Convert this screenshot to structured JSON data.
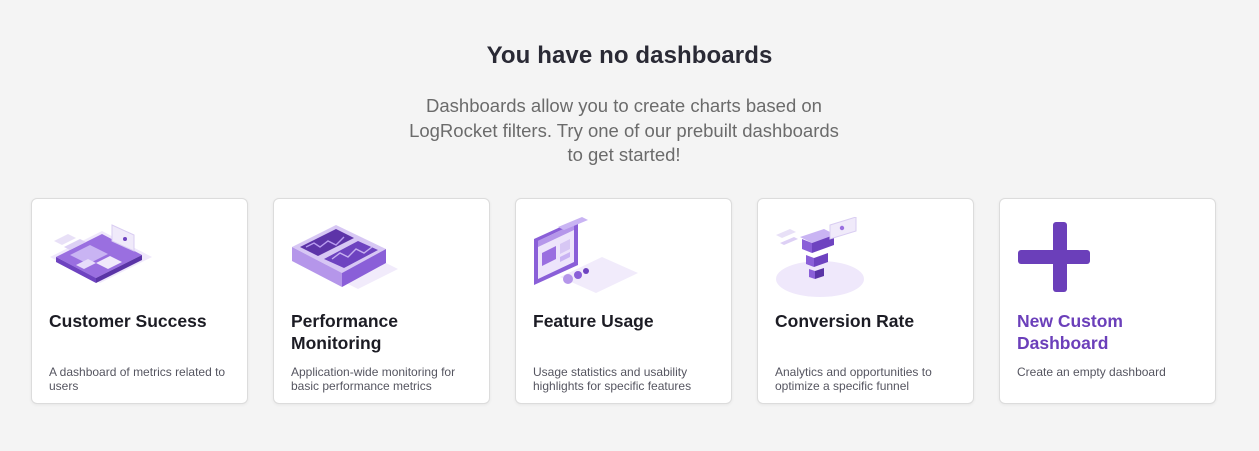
{
  "heading": "You have no dashboards",
  "description": "Dashboards allow you to create charts based on LogRocket filters. Try one of our prebuilt dashboards to get started!",
  "cards": [
    {
      "title": "Customer Success",
      "description": "A dashboard of metrics related to users",
      "icon": "customer-success-illustration"
    },
    {
      "title": "Performance Monitoring",
      "description": "Application-wide monitoring for basic performance metrics",
      "icon": "performance-monitoring-illustration"
    },
    {
      "title": "Feature Usage",
      "description": "Usage statistics and usability highlights for specific features",
      "icon": "feature-usage-illustration"
    },
    {
      "title": "Conversion Rate",
      "description": "Analytics and opportunities to optimize a specific funnel",
      "icon": "conversion-rate-illustration"
    },
    {
      "title": "New Custom Dashboard",
      "description": "Create an empty dashboard",
      "icon": "plus-icon"
    }
  ],
  "colors": {
    "accent": "#6b3fba",
    "background": "#f4f4f4"
  }
}
